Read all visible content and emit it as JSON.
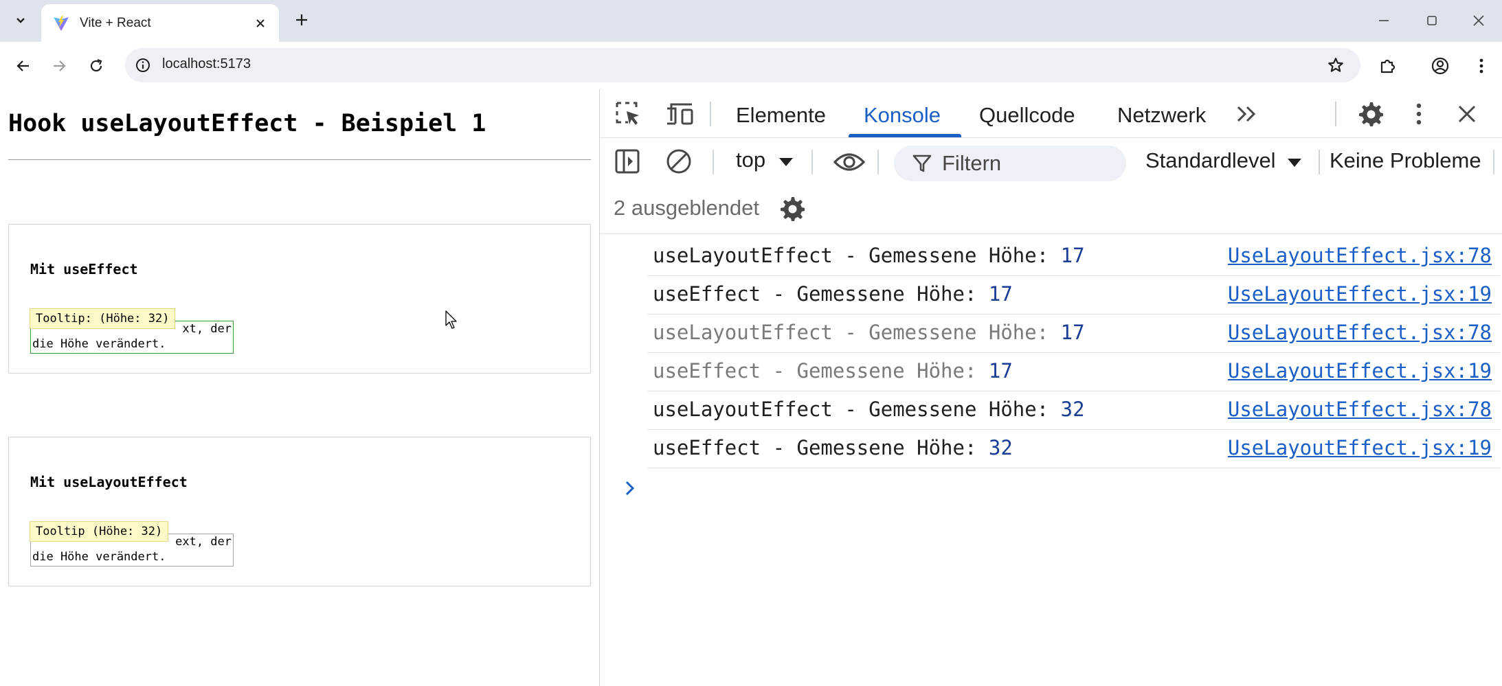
{
  "browser": {
    "tab_title": "Vite + React",
    "url": "localhost:5173"
  },
  "page": {
    "heading": "Hook useLayoutEffect - Beispiel 1",
    "cards": [
      {
        "title": "Mit useEffect",
        "text_line1": "xt, der",
        "text_line2": "die Höhe verändert.",
        "tooltip": "Tooltip: (Höhe: 32)"
      },
      {
        "title": "Mit useLayoutEffect",
        "text_line1": "ext, der",
        "text_line2": "die Höhe verändert.",
        "tooltip": "Tooltip (Höhe: 32)"
      }
    ]
  },
  "devtools": {
    "tabs": [
      "Elemente",
      "Konsole",
      "Quellcode",
      "Netzwerk"
    ],
    "active_tab": "Konsole",
    "context": "top",
    "filter_placeholder": "Filtern",
    "levels": "Standardlevel",
    "issues": "Keine Probleme",
    "hidden_count": "2 ausgeblendet",
    "logs": [
      {
        "label": "useLayoutEffect - Gemessene Höhe: ",
        "value": "17",
        "source": "UseLayoutEffect.jsx:78",
        "faded": false
      },
      {
        "label": "useEffect - Gemessene Höhe: ",
        "value": "17",
        "source": "UseLayoutEffect.jsx:19",
        "faded": false
      },
      {
        "label": "useLayoutEffect - Gemessene Höhe: ",
        "value": "17",
        "source": "UseLayoutEffect.jsx:78",
        "faded": true
      },
      {
        "label": "useEffect - Gemessene Höhe: ",
        "value": "17",
        "source": "UseLayoutEffect.jsx:19",
        "faded": true
      },
      {
        "label": "useLayoutEffect - Gemessene Höhe: ",
        "value": "32",
        "source": "UseLayoutEffect.jsx:78",
        "faded": false
      },
      {
        "label": "useEffect - Gemessene Höhe: ",
        "value": "32",
        "source": "UseLayoutEffect.jsx:19",
        "faded": false
      }
    ]
  },
  "colors": {
    "accent": "#1a5fc6",
    "tooltip_bg": "#fdfac8",
    "measured_border": "#3c9a3c"
  }
}
